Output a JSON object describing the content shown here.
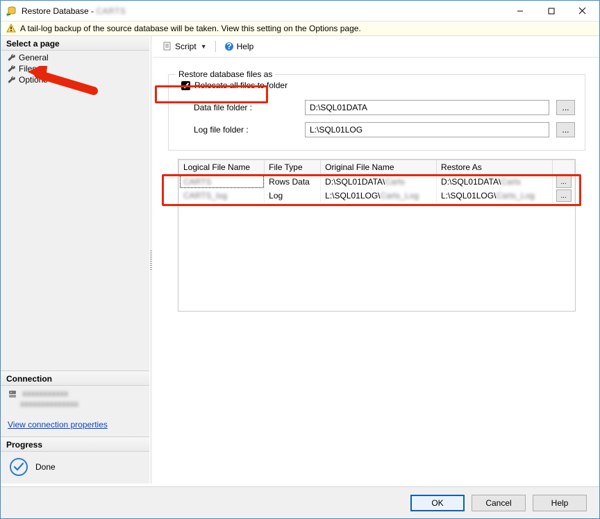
{
  "window": {
    "title_prefix": "Restore Database - ",
    "title_blurred": "CARTS"
  },
  "warning": {
    "text": "A tail-log backup of the source database will be taken. View this setting on the Options page."
  },
  "sidebar": {
    "header": "Select a page",
    "items": [
      {
        "label": "General"
      },
      {
        "label": "Files"
      },
      {
        "label": "Options"
      }
    ],
    "connection_header": "Connection",
    "conn_line1": "xxxxxxxxxxx",
    "conn_line2": "xxxxxxxxxxxxxx",
    "view_link": "View connection properties",
    "progress_header": "Progress",
    "progress_status": "Done"
  },
  "strip": {
    "script_label": "Script",
    "help_label": "Help"
  },
  "content": {
    "group_legend": "Restore database files as",
    "relocate_checkbox": "Relocate all files to folder",
    "relocate_checked": true,
    "data_label": "Data file folder :",
    "data_value": "D:\\SQL01DATA",
    "log_label": "Log file folder :",
    "log_value": "L:\\SQL01LOG",
    "browse_ellipsis": "..."
  },
  "table": {
    "headers": [
      "Logical File Name",
      "File Type",
      "Original File Name",
      "Restore As",
      ""
    ],
    "rows": [
      {
        "logical": "CARTS",
        "ftype": "Rows Data",
        "orig_prefix": "D:\\SQL01DATA\\",
        "orig_blur": "Carts",
        "rest_prefix": "D:\\SQL01DATA\\",
        "rest_blur": "Carts"
      },
      {
        "logical": "CARTS_log",
        "ftype": "Log",
        "orig_prefix": "L:\\SQL01LOG\\",
        "orig_blur": "Carts_Log",
        "rest_prefix": "L:\\SQL01LOG\\",
        "rest_blur": "Carts_Log"
      }
    ]
  },
  "buttons": {
    "ok": "OK",
    "cancel": "Cancel",
    "help": "Help"
  }
}
